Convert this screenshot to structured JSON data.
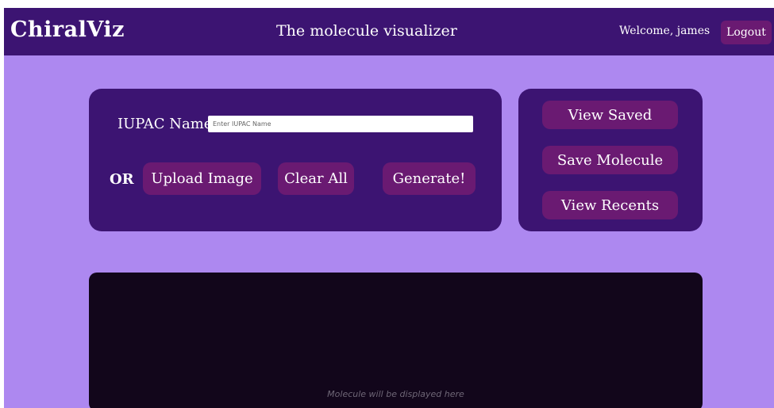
{
  "header": {
    "brand": "ChiralViz",
    "tagline": "The molecule visualizer",
    "welcome": "Welcome, james",
    "logout_label": "Logout"
  },
  "input_panel": {
    "iupac_label": "IUPAC Name:",
    "iupac_placeholder": "Enter IUPAC Name",
    "iupac_value": "",
    "or_label": "OR",
    "upload_label": "Upload Image",
    "clear_label": "Clear All",
    "generate_label": "Generate!"
  },
  "side_panel": {
    "view_saved_label": "View Saved",
    "save_molecule_label": "Save Molecule",
    "view_recents_label": "View Recents"
  },
  "viewer": {
    "caption": "Molecule will be displayed here"
  },
  "colors": {
    "background": "#ad88f0",
    "header": "#3c1472",
    "panel": "#3c1472",
    "button": "#6a1a72",
    "viewer": "#12061b"
  }
}
